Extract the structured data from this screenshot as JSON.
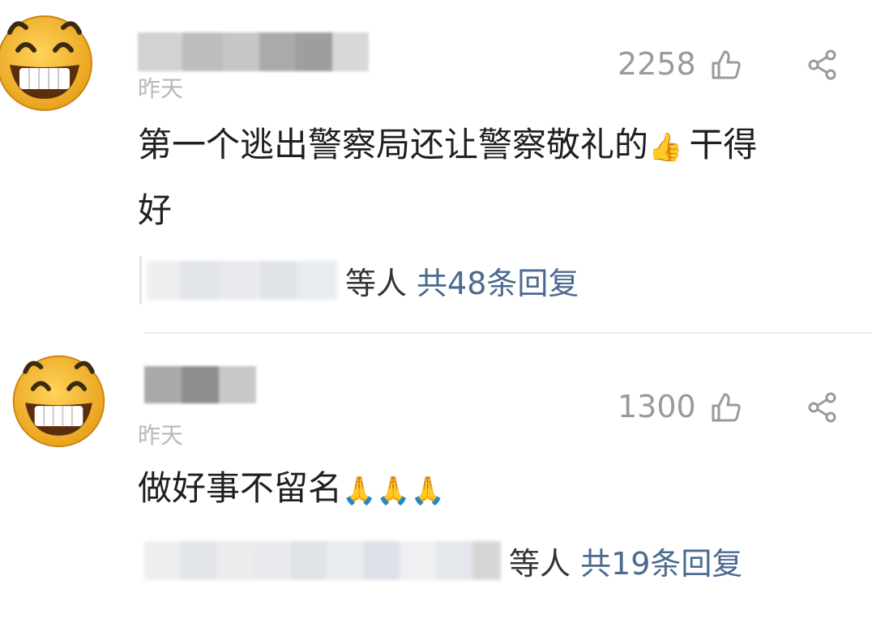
{
  "comments": [
    {
      "time": "昨天",
      "likes": "2258",
      "text_line1": "第一个逃出警察局还让警察敬礼的",
      "emoji": "👍",
      "text_line2": "干得",
      "text_line3": "好",
      "reply_who": "等人",
      "reply_count": "共48条回复"
    },
    {
      "time": "昨天",
      "likes": "1300",
      "text": "做好事不留名",
      "emoji": "🙏🙏🙏",
      "reply_who": "等人",
      "reply_count": "共19条回复"
    }
  ],
  "colors": {
    "reply_link": "#4a6a90",
    "muted": "#9a9a9a",
    "avatar_face": "#f5b82a"
  },
  "icons": [
    "laughing-emoji-avatar",
    "thumbs-up-icon",
    "share-icon"
  ]
}
